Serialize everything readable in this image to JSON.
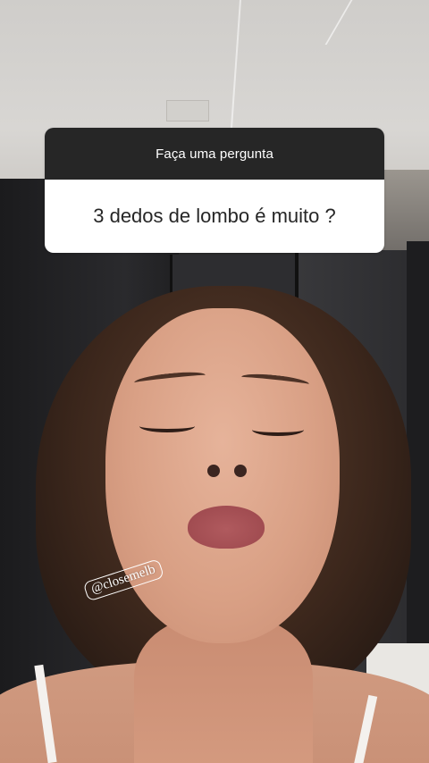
{
  "story": {
    "question_sticker": {
      "prompt": "Faça uma pergunta",
      "question": "3 dedos de lombo é muito ?"
    },
    "mention_sticker": {
      "handle": "@closemelb"
    }
  },
  "colors": {
    "sticker_header_bg": "#262626",
    "sticker_body_bg": "#ffffff",
    "sticker_text_dark": "#262626"
  }
}
